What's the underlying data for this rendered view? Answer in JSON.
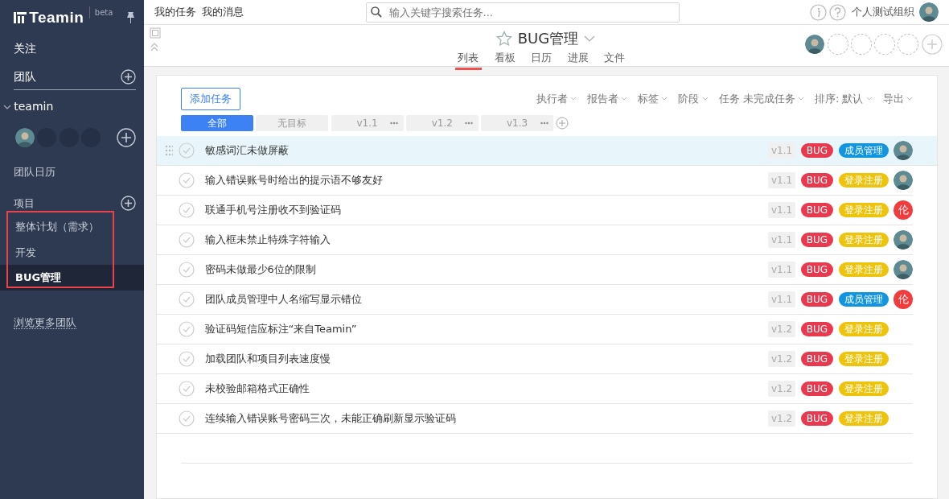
{
  "sidebar": {
    "logo": "Teamin",
    "beta": "beta",
    "follow": "关注",
    "team_heading": "团队",
    "team": {
      "name": "teamin",
      "expanded": true
    },
    "team_calendar": "团队日历",
    "projects_heading": "项目",
    "projects": [
      {
        "label": "整体计划（需求）",
        "selected": false
      },
      {
        "label": "开发",
        "selected": false
      },
      {
        "label": "BUG管理",
        "selected": true
      }
    ],
    "more_teams": "浏览更多团队"
  },
  "topbar": {
    "links": [
      "我的任务",
      "我的消息"
    ],
    "search": {
      "placeholder": "输入关键字搜索任务..."
    },
    "org": "个人测试组织"
  },
  "project": {
    "title": "BUG管理",
    "starred": false,
    "tabs": [
      {
        "label": "列表",
        "selected": true
      },
      {
        "label": "看板",
        "selected": false
      },
      {
        "label": "日历",
        "selected": false
      },
      {
        "label": "进展",
        "selected": false
      },
      {
        "label": "文件",
        "selected": false
      }
    ]
  },
  "toolbar": {
    "add_button": "添加任务",
    "filters": [
      "执行者",
      "报告者",
      "标签",
      "阶段",
      "任务 未完成任务",
      "排序: 默认",
      "导出"
    ]
  },
  "milestones": [
    {
      "label": "全部",
      "selected": true,
      "menu": false
    },
    {
      "label": "无目标",
      "selected": false,
      "menu": false
    },
    {
      "label": "v1.1",
      "selected": false,
      "menu": true
    },
    {
      "label": "v1.2",
      "selected": false,
      "menu": true
    },
    {
      "label": "v1.3",
      "selected": false,
      "menu": true
    }
  ],
  "tasks": [
    {
      "title": "敏感词汇未做屏蔽",
      "version": "v1.1",
      "selected": true,
      "tags": [
        {
          "label": "BUG",
          "color": "#e8394f"
        },
        {
          "label": "成员管理",
          "color": "#1195e0"
        }
      ],
      "assignee": {
        "kind": "photo"
      }
    },
    {
      "title": "输入错误账号时给出的提示语不够友好",
      "version": "v1.1",
      "selected": false,
      "tags": [
        {
          "label": "BUG",
          "color": "#e8394f"
        },
        {
          "label": "登录注册",
          "color": "#eec30b"
        }
      ],
      "assignee": {
        "kind": "photo"
      }
    },
    {
      "title": "联通手机号注册收不到验证码",
      "version": "v1.1",
      "selected": false,
      "tags": [
        {
          "label": "BUG",
          "color": "#e8394f"
        },
        {
          "label": "登录注册",
          "color": "#eec30b"
        }
      ],
      "assignee": {
        "kind": "initial",
        "text": "伦"
      }
    },
    {
      "title": "输入框未禁止特殊字符输入",
      "version": "v1.1",
      "selected": false,
      "tags": [
        {
          "label": "BUG",
          "color": "#e8394f"
        },
        {
          "label": "登录注册",
          "color": "#eec30b"
        }
      ],
      "assignee": {
        "kind": "photo"
      }
    },
    {
      "title": "密码未做最少6位的限制",
      "version": "v1.1",
      "selected": false,
      "tags": [
        {
          "label": "BUG",
          "color": "#e8394f"
        },
        {
          "label": "登录注册",
          "color": "#eec30b"
        }
      ],
      "assignee": {
        "kind": "photo"
      }
    },
    {
      "title": "团队成员管理中人名缩写显示错位",
      "version": "v1.1",
      "selected": false,
      "tags": [
        {
          "label": "BUG",
          "color": "#e8394f"
        },
        {
          "label": "成员管理",
          "color": "#1195e0"
        }
      ],
      "assignee": {
        "kind": "initial",
        "text": "伦"
      }
    },
    {
      "title": "验证码短信应标注“来自Teamin”",
      "version": "v1.2",
      "selected": false,
      "tags": [
        {
          "label": "BUG",
          "color": "#e8394f"
        },
        {
          "label": "登录注册",
          "color": "#eec30b"
        }
      ]
    },
    {
      "title": "加载团队和项目列表速度慢",
      "version": "v1.2",
      "selected": false,
      "tags": [
        {
          "label": "BUG",
          "color": "#e8394f"
        },
        {
          "label": "登录注册",
          "color": "#eec30b"
        }
      ]
    },
    {
      "title": "未校验邮箱格式正确性",
      "version": "v1.2",
      "selected": false,
      "tags": [
        {
          "label": "BUG",
          "color": "#e8394f"
        },
        {
          "label": "登录注册",
          "color": "#eec30b"
        }
      ]
    },
    {
      "title": "连续输入错误账号密码三次，未能正确刷新显示验证码",
      "version": "v1.2",
      "selected": false,
      "tags": [
        {
          "label": "BUG",
          "color": "#e8394f"
        },
        {
          "label": "登录注册",
          "color": "#eec30b"
        }
      ]
    }
  ]
}
